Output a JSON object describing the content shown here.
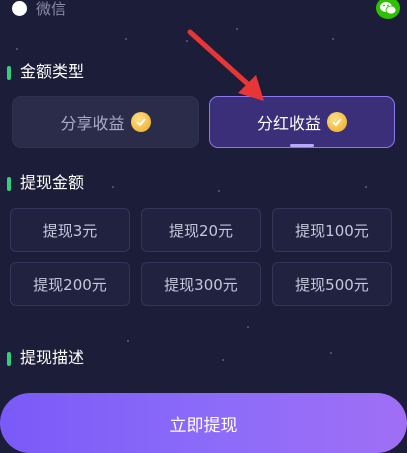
{
  "payment": {
    "selected_method": "微信"
  },
  "sections": {
    "amount_type": "金额类型",
    "withdraw_amount": "提现金额",
    "withdraw_desc": "提现描述"
  },
  "type_options": [
    {
      "label": "分享收益",
      "active": false
    },
    {
      "label": "分红收益",
      "active": true
    }
  ],
  "amounts": [
    "提现3元",
    "提现20元",
    "提现100元",
    "提现200元",
    "提现300元",
    "提现500元"
  ],
  "submit_label": "立即提现",
  "colors": {
    "background": "#1c1d38",
    "accent_green": "#2fd17a",
    "active_border": "#8b77f0",
    "button_gradient_start": "#7a5af8",
    "arrow_red": "#e83535"
  }
}
